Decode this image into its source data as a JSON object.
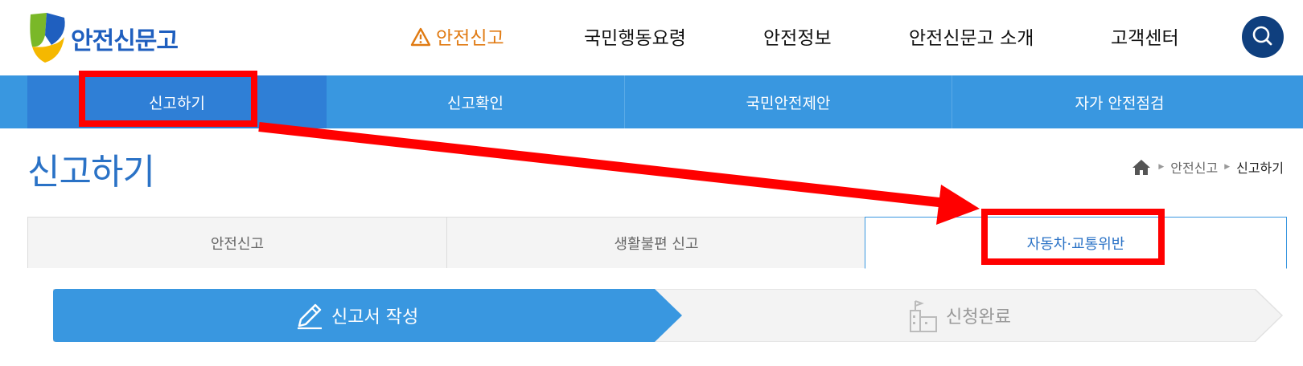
{
  "header": {
    "logo_text": "안전신문고",
    "nav": [
      {
        "label": "안전신고",
        "active": true
      },
      {
        "label": "국민행동요령",
        "active": false
      },
      {
        "label": "안전정보",
        "active": false
      },
      {
        "label": "안전신문고 소개",
        "active": false
      },
      {
        "label": "고객센터",
        "active": false
      }
    ],
    "search_icon": "search-icon",
    "warn_icon": "warning-icon"
  },
  "subnav": {
    "items": [
      {
        "label": "신고하기",
        "active": true
      },
      {
        "label": "신고확인",
        "active": false
      },
      {
        "label": "국민안전제안",
        "active": false
      },
      {
        "label": "자가 안전점검",
        "active": false
      }
    ]
  },
  "page": {
    "title": "신고하기",
    "breadcrumb": [
      "안전신고",
      "신고하기"
    ],
    "home_icon": "home-icon"
  },
  "tabs": [
    {
      "label": "안전신고",
      "active": false
    },
    {
      "label": "생활불편 신고",
      "active": false
    },
    {
      "label": "자동차·교통위반",
      "active": true
    }
  ],
  "steps": [
    {
      "label": "신고서 작성",
      "icon": "pencil-icon",
      "active": true
    },
    {
      "label": "신청완료",
      "icon": "building-icon",
      "active": false
    }
  ],
  "colors": {
    "brand_blue": "#3997e0",
    "dark_blue": "#0f3f7e",
    "title_blue": "#2a72c6",
    "accent_orange": "#e07a12",
    "annotation_red": "#ff0000"
  }
}
